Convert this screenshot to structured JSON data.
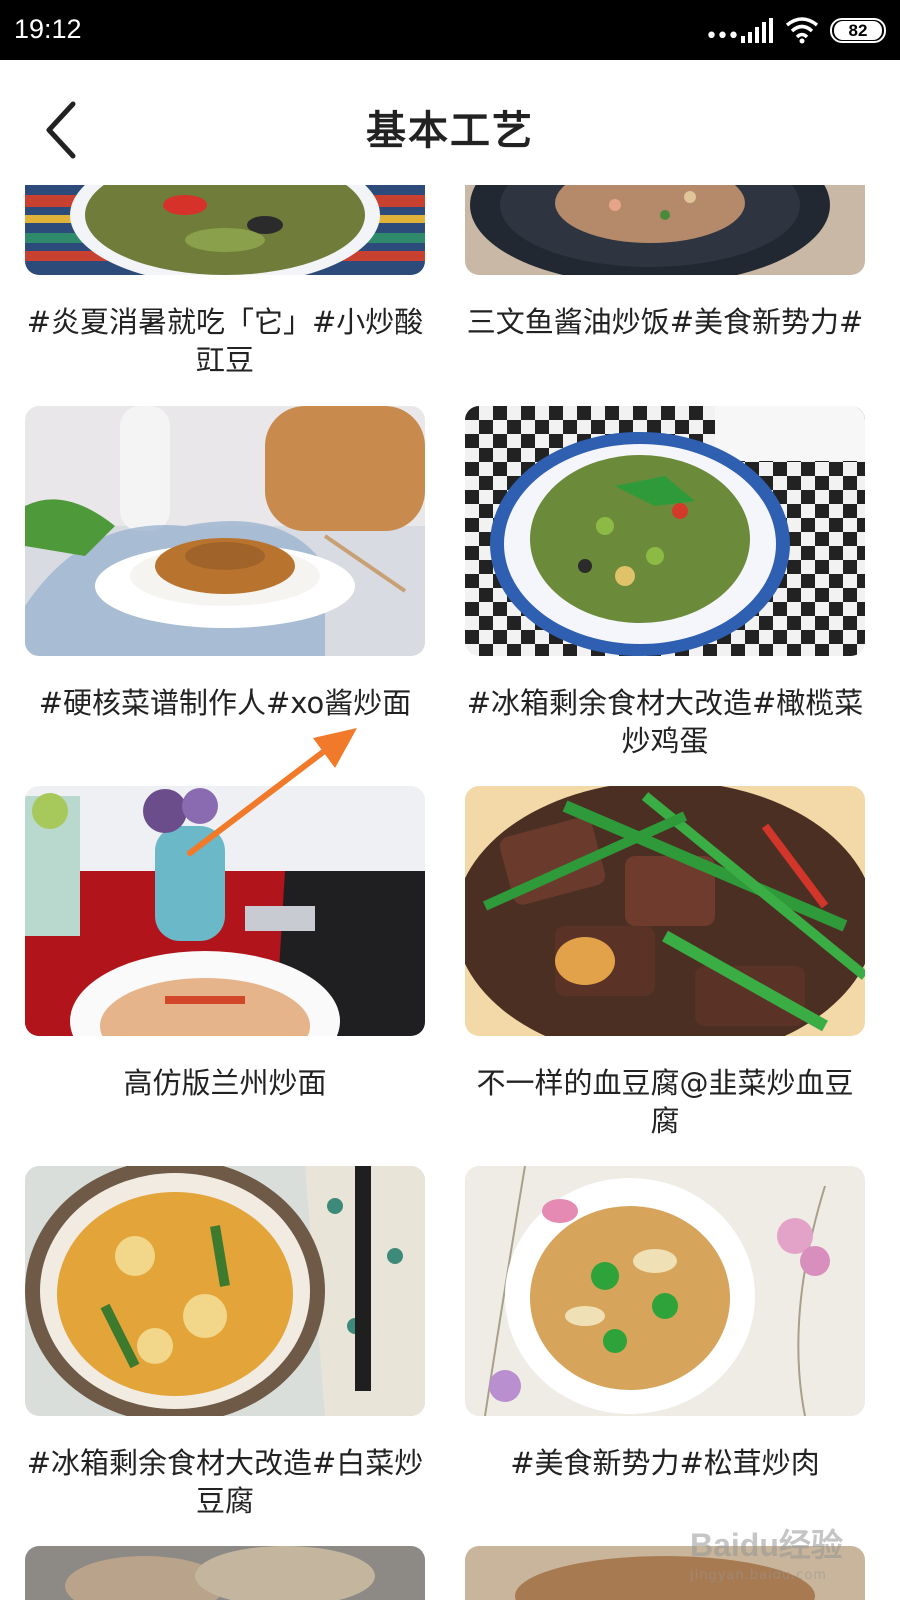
{
  "status_bar": {
    "time": "19:12",
    "dots": "•••",
    "battery": "82"
  },
  "header": {
    "title": "基本工艺"
  },
  "recipes": [
    {
      "caption": "#炎夏消暑就吃「它」#小炒酸豇豆"
    },
    {
      "caption": "三文鱼酱油炒饭#美食新势力#"
    },
    {
      "caption": "#硬核菜谱制作人#xo酱炒面"
    },
    {
      "caption": "#冰箱剩余食材大改造#橄榄菜炒鸡蛋"
    },
    {
      "caption": "高仿版兰州炒面"
    },
    {
      "caption": "不一样的血豆腐@韭菜炒血豆腐"
    },
    {
      "caption": "#冰箱剩余食材大改造#白菜炒豆腐"
    },
    {
      "caption": "#美食新势力#松茸炒肉"
    }
  ],
  "watermark": {
    "main": "Baidu经验",
    "sub": "jingyan.baidu.com"
  },
  "colors": {
    "annotation_arrow": "#f07a2a",
    "status_bar_bg": "#000000"
  }
}
